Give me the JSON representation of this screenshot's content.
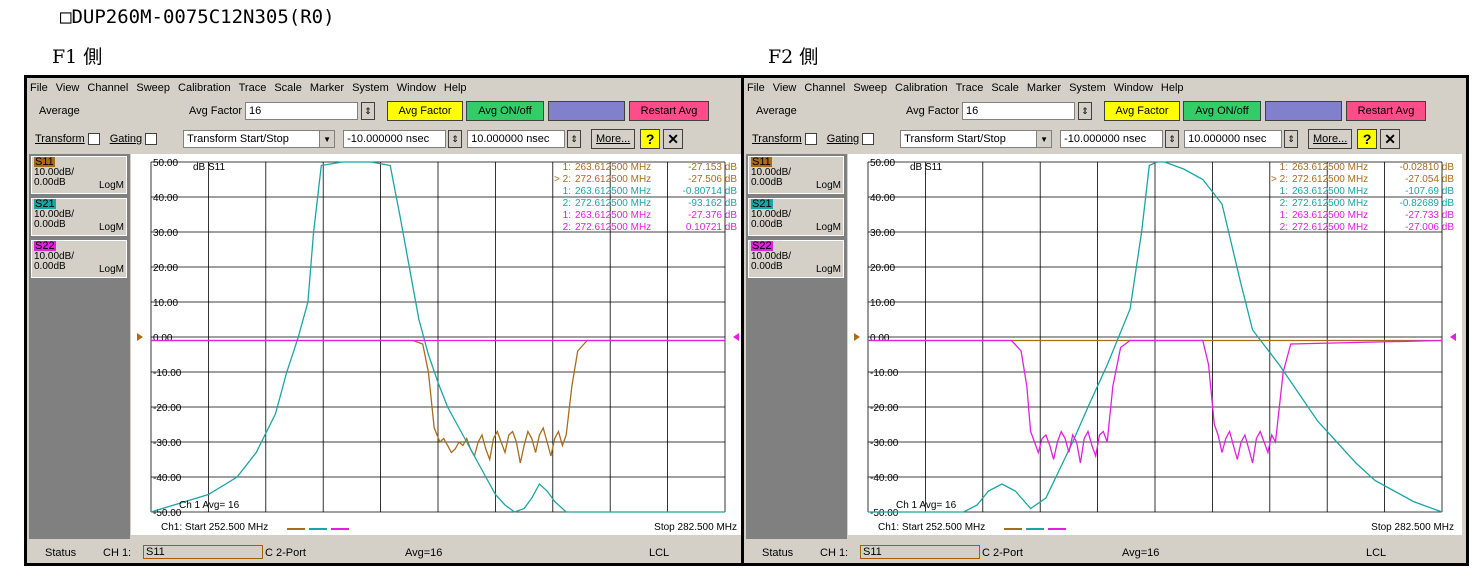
{
  "document_title": "□DUP260M-0075C12N305(R0)",
  "windows": [
    {
      "side_label": "F1 側",
      "menu": [
        "File",
        "View",
        "Channel",
        "Sweep",
        "Calibration",
        "Trace",
        "Scale",
        "Marker",
        "System",
        "Window",
        "Help"
      ],
      "softkeys": {
        "average_label": "Average",
        "avg_factor_label": "Avg Factor",
        "avg_factor_value": "16",
        "avg_factor_button": "Avg Factor",
        "avg_onoff_button": "Avg ON/off",
        "restart_button": "Restart Avg",
        "transform_label": "Transform",
        "gating_label": "Gating",
        "transform_select": "Transform Start/Stop",
        "start_value": "-10.000000 nsec",
        "stop_value": "10.000000 nsec",
        "more_button": "More...",
        "help_button": "?",
        "close_button": "✕"
      },
      "traces": [
        {
          "name": "S11",
          "scale": "10.00dB/",
          "ref": "0.00dB",
          "format": "LogM",
          "color": "#a86c1c"
        },
        {
          "name": "S21",
          "scale": "10.00dB/",
          "ref": "0.00dB",
          "format": "LogM",
          "color": "#1aa5a5"
        },
        {
          "name": "S22",
          "scale": "10.00dB/",
          "ref": "0.00dB",
          "format": "LogM",
          "color": "#e020e0"
        }
      ],
      "plot_title": "dB S11",
      "ytick_labels": [
        "50.00",
        "40.00",
        "30.00",
        "20.00",
        "10.00",
        "0.00",
        "-10.00",
        "-20.00",
        "-30.00",
        "-40.00",
        "-50.00"
      ],
      "markers": [
        {
          "id": "1:",
          "freq": "263.612500 MHz",
          "value": "-27.153 dB",
          "color": "#a86c1c"
        },
        {
          "id": "> 2:",
          "freq": "272.612500 MHz",
          "value": "-27.506 dB",
          "color": "#a86c1c"
        },
        {
          "id": "1:",
          "freq": "263.612500 MHz",
          "value": "-0.80714 dB",
          "color": "#1aa5a5"
        },
        {
          "id": "2:",
          "freq": "272.612500 MHz",
          "value": "-93.162 dB",
          "color": "#1aa5a5"
        },
        {
          "id": "1:",
          "freq": "263.612500 MHz",
          "value": "-27.376 dB",
          "color": "#e020e0"
        },
        {
          "id": "2:",
          "freq": "272.612500 MHz",
          "value": "0.10721 dB",
          "color": "#e020e0"
        }
      ],
      "avg_readout": "Ch 1 Avg=  16",
      "start_freq": "Ch1: Start  252.500 MHz",
      "stop_freq": "Stop  282.500 MHz",
      "status": {
        "label": "Status",
        "channel": "CH 1:",
        "param": "S11",
        "port": "C  2-Port",
        "avg": "Avg=16",
        "lcl": "LCL"
      },
      "chart_data": {
        "type": "line",
        "x_range_mhz": [
          252.5,
          282.5
        ],
        "ylim": [
          -50,
          50
        ],
        "grid": true,
        "series": [
          {
            "name": "S11",
            "color": "#a86c1c",
            "role": "Tx_S11",
            "x": [
              252.5,
              266.2,
              266.7,
              267.0,
              267.3,
              267.6,
              267.8,
              268.0,
              268.2,
              268.4,
              268.6,
              268.8,
              269.0,
              269.2,
              269.4,
              269.6,
              269.8,
              270.0,
              270.2,
              270.4,
              270.6,
              270.8,
              271.0,
              271.2,
              271.4,
              271.6,
              271.8,
              272.0,
              272.2,
              272.4,
              272.6,
              272.8,
              273.0,
              273.2,
              273.4,
              273.6,
              273.8,
              274.0,
              274.2,
              274.5,
              274.8,
              275.3,
              282.5
            ],
            "y": [
              -1,
              -1,
              -2,
              -10,
              -26,
              -30,
              -29,
              -31,
              -33,
              -32,
              -30,
              -31,
              -29,
              -32,
              -34,
              -30,
              -28,
              -32,
              -35,
              -29,
              -27,
              -30,
              -33,
              -28,
              -27,
              -30,
              -36,
              -31,
              -27,
              -29,
              -33,
              -28,
              -26,
              -30,
              -34,
              -29,
              -27,
              -31,
              -28,
              -14,
              -4,
              -1,
              -1
            ]
          },
          {
            "name": "S21",
            "color": "#1aa5a5",
            "role": "Tx_S21",
            "x": [
              252.5,
              255.5,
              257.0,
              258.0,
              259.0,
              259.6,
              260.2,
              260.7,
              261.0,
              261.4,
              262.5,
              264.0,
              265.0,
              265.5,
              266.0,
              266.5,
              267.0,
              267.5,
              268.0,
              269.0,
              270.0,
              270.5,
              271.0,
              271.5,
              272.0,
              272.4,
              272.8,
              273.2,
              273.6,
              274.2,
              274.8,
              282.5
            ],
            "y": [
              -50,
              -45,
              -40,
              -33,
              -22,
              -10,
              0,
              10,
              30,
              49,
              50,
              50,
              49,
              35,
              20,
              5,
              -5,
              -13,
              -20,
              -30,
              -40,
              -45,
              -48,
              -50,
              -49,
              -46,
              -42,
              -44,
              -47,
              -50,
              -50,
              -50
            ]
          },
          {
            "name": "S22",
            "color": "#e020e0",
            "role": "Tx_S22",
            "x": [
              252.5,
              282.5
            ],
            "y": [
              -1,
              -1
            ]
          }
        ]
      }
    },
    {
      "side_label": "F2 側",
      "menu": [
        "File",
        "View",
        "Channel",
        "Sweep",
        "Calibration",
        "Trace",
        "Scale",
        "Marker",
        "System",
        "Window",
        "Help"
      ],
      "softkeys": {
        "average_label": "Average",
        "avg_factor_label": "Avg Factor",
        "avg_factor_value": "16",
        "avg_factor_button": "Avg Factor",
        "avg_onoff_button": "Avg ON/off",
        "restart_button": "Restart Avg",
        "transform_label": "Transform",
        "gating_label": "Gating",
        "transform_select": "Transform Start/Stop",
        "start_value": "-10.000000 nsec",
        "stop_value": "10.000000 nsec",
        "more_button": "More...",
        "help_button": "?",
        "close_button": "✕"
      },
      "traces": [
        {
          "name": "S11",
          "scale": "10.00dB/",
          "ref": "0.00dB",
          "format": "LogM",
          "color": "#a86c1c"
        },
        {
          "name": "S21",
          "scale": "10.00dB/",
          "ref": "0.00dB",
          "format": "LogM",
          "color": "#1aa5a5"
        },
        {
          "name": "S22",
          "scale": "10.00dB/",
          "ref": "0.00dB",
          "format": "LogM",
          "color": "#e020e0"
        }
      ],
      "plot_title": "dB S11",
      "ytick_labels": [
        "50.00",
        "40.00",
        "30.00",
        "20.00",
        "10.00",
        "0.00",
        "-10.00",
        "-20.00",
        "-30.00",
        "-40.00",
        "-50.00"
      ],
      "markers": [
        {
          "id": "1:",
          "freq": "263.612500 MHz",
          "value": "-0.02810 dB",
          "color": "#a86c1c"
        },
        {
          "id": "> 2:",
          "freq": "272.612500 MHz",
          "value": "-27.054 dB",
          "color": "#a86c1c"
        },
        {
          "id": "1:",
          "freq": "263.612500 MHz",
          "value": "-107.69 dB",
          "color": "#1aa5a5"
        },
        {
          "id": "2:",
          "freq": "272.612500 MHz",
          "value": "-0.82689 dB",
          "color": "#1aa5a5"
        },
        {
          "id": "1:",
          "freq": "263.612500 MHz",
          "value": "-27.733 dB",
          "color": "#e020e0"
        },
        {
          "id": "2:",
          "freq": "272.612500 MHz",
          "value": "-27.006 dB",
          "color": "#e020e0"
        }
      ],
      "avg_readout": "Ch 1 Avg=  16",
      "start_freq": "Ch1: Start  252.500 MHz",
      "stop_freq": "Stop  282.500 MHz",
      "status": {
        "label": "Status",
        "channel": "CH 1:",
        "param": "S11",
        "port": "C  2-Port",
        "avg": "Avg=16",
        "lcl": "LCL"
      },
      "chart_data": {
        "type": "line",
        "x_range_mhz": [
          252.5,
          282.5
        ],
        "ylim": [
          -50,
          50
        ],
        "grid": true,
        "series": [
          {
            "name": "S11",
            "color": "#a86c1c",
            "role": "Rx_S11",
            "x": [
              252.5,
              282.5
            ],
            "y": [
              -1,
              -1
            ]
          },
          {
            "name": "S21",
            "color": "#1aa5a5",
            "role": "Rx_S21",
            "x": [
              252.5,
              257.5,
              258.2,
              258.8,
              259.5,
              260.2,
              261.0,
              261.8,
              262.5,
              263.2,
              264.0,
              265.0,
              266.2,
              266.8,
              267.2,
              267.6,
              268.0,
              268.5,
              269.0,
              270.0,
              271.0,
              272.0,
              272.6,
              274.0,
              275.0,
              276.0,
              277.0,
              278.0,
              279.0,
              280.0,
              281.0,
              282.5
            ],
            "y": [
              -50,
              -50,
              -48,
              -44,
              -42,
              -44,
              -49,
              -46,
              -38,
              -30,
              -20,
              -8,
              8,
              30,
              49,
              50,
              50,
              49,
              48,
              45,
              38,
              15,
              2,
              -8,
              -16,
              -24,
              -30,
              -36,
              -41,
              -44,
              -47,
              -50
            ]
          },
          {
            "name": "S22",
            "color": "#e020e0",
            "role": "Rx_S22",
            "x": [
              252.5,
              260.0,
              260.5,
              260.8,
              261.0,
              261.2,
              261.4,
              261.6,
              261.8,
              262.0,
              262.2,
              262.4,
              262.6,
              262.8,
              263.0,
              263.2,
              263.4,
              263.6,
              263.8,
              264.0,
              264.2,
              264.4,
              264.6,
              264.8,
              265.0,
              265.3,
              265.7,
              266.2,
              270.0,
              270.3,
              270.6,
              270.8,
              271.0,
              271.2,
              271.4,
              271.6,
              271.8,
              272.0,
              272.2,
              272.4,
              272.6,
              272.8,
              273.0,
              273.2,
              273.4,
              273.6,
              273.8,
              274.2,
              274.6,
              282.5
            ],
            "y": [
              -1,
              -1,
              -4,
              -14,
              -27,
              -30,
              -33,
              -29,
              -28,
              -31,
              -35,
              -30,
              -27,
              -29,
              -33,
              -28,
              -30,
              -36,
              -29,
              -27,
              -31,
              -34,
              -28,
              -27,
              -30,
              -14,
              -3,
              -1,
              -1,
              -8,
              -25,
              -28,
              -33,
              -29,
              -27,
              -31,
              -35,
              -30,
              -28,
              -32,
              -36,
              -29,
              -27,
              -30,
              -33,
              -28,
              -30,
              -10,
              -2,
              -1
            ]
          }
        ]
      }
    }
  ]
}
